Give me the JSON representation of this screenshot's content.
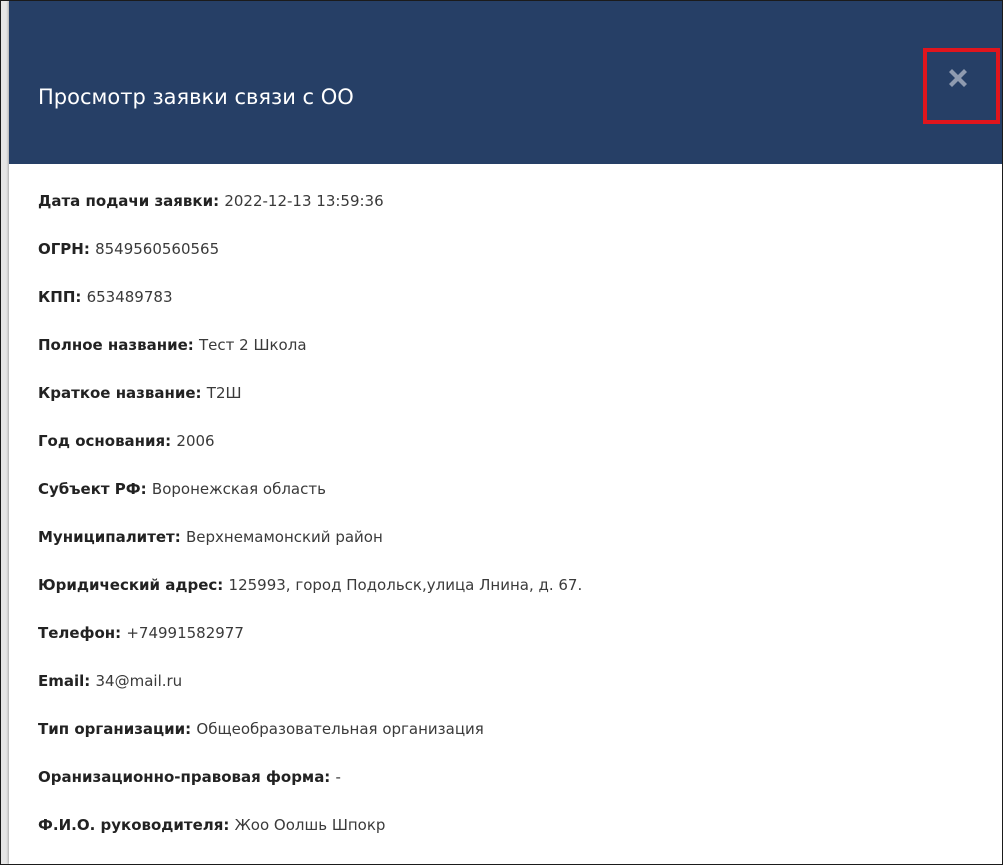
{
  "modal": {
    "title": "Просмотр заявки связи с ОО",
    "close_icon": "close-icon",
    "colors": {
      "header_bg": "#263f66",
      "highlight_border": "#e0151d",
      "close_icon_color": "#8f9bb0"
    }
  },
  "fields": [
    {
      "label": "Дата подачи заявки:",
      "value": "2022-12-13 13:59:36"
    },
    {
      "label": "ОГРН:",
      "value": "8549560560565"
    },
    {
      "label": "КПП:",
      "value": "653489783"
    },
    {
      "label": "Полное название:",
      "value": "Тест 2 Школа"
    },
    {
      "label": "Краткое название:",
      "value": "Т2Ш"
    },
    {
      "label": "Год основания:",
      "value": "2006"
    },
    {
      "label": "Субъект РФ:",
      "value": "Воронежская область"
    },
    {
      "label": "Муниципалитет:",
      "value": "Верхнемамонский район"
    },
    {
      "label": "Юридический адрес:",
      "value": "125993, город Подольск,улица Лнина, д. 67."
    },
    {
      "label": "Телефон:",
      "value": "+74991582977"
    },
    {
      "label": "Email:",
      "value": "34@mail.ru"
    },
    {
      "label": "Тип организации:",
      "value": "Общеобразовательная организация"
    },
    {
      "label": "Оранизационно-правовая форма:",
      "value": "-"
    },
    {
      "label": "Ф.И.О. руководителя:",
      "value": "Жоо Оолшь Шпокр"
    }
  ]
}
